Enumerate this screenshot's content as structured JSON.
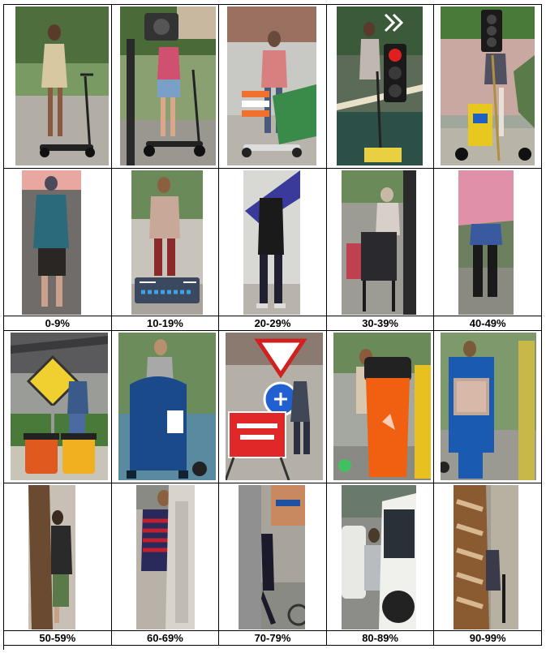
{
  "rows": [
    {
      "cells": [
        {
          "scene": "scooter-woman-park",
          "bg": "#7a9a64"
        },
        {
          "scene": "scooter-woman-shorts-cam",
          "bg": "#8aa070"
        },
        {
          "scene": "scooter-man-barrier",
          "bg": "#b8b4ac"
        },
        {
          "scene": "scooter-woman-trafficlight",
          "bg": "#5c6a58"
        },
        {
          "scene": "scooter-sign-trafficlight",
          "bg": "#a0a89c"
        }
      ]
    },
    {
      "cells": [
        {
          "scene": "man-walking-road",
          "bg": "#6f6c6a"
        },
        {
          "scene": "man-walking-sign",
          "bg": "#c8c4bc"
        },
        {
          "scene": "person-umbrella-blue",
          "bg": "#d8d8d4"
        },
        {
          "scene": "elderly-walker",
          "bg": "#9c9c94"
        },
        {
          "scene": "person-umbrella-pink",
          "bg": "#6c8060"
        }
      ],
      "labels": [
        "0-9%",
        "10-19%",
        "20-29%",
        "30-39%",
        "40-49%"
      ]
    },
    {
      "cells": [
        {
          "scene": "diamond-sign-bins",
          "bg": "#9a9c98"
        },
        {
          "scene": "mailbox-man",
          "bg": "#6d8c5c"
        },
        {
          "scene": "footpath-closed",
          "bg": "#b4b0a8"
        },
        {
          "scene": "orange-bin-scooter",
          "bg": "#a4a8a0"
        },
        {
          "scene": "blue-newsbox",
          "bg": "#7e9a6c"
        }
      ]
    },
    {
      "cells": [
        {
          "scene": "tree-occluded",
          "bg": "#c8c0b4"
        },
        {
          "scene": "pillar-occluded",
          "bg": "#b8b2a8"
        },
        {
          "scene": "pole-occluded",
          "bg": "#a8a49c"
        },
        {
          "scene": "van-occluded",
          "bg": "#8c8c88"
        },
        {
          "scene": "palm-occluded",
          "bg": "#a09c90"
        }
      ],
      "labels": [
        "50-59%",
        "60-69%",
        "70-79%",
        "80-89%",
        "90-99%"
      ]
    }
  ]
}
